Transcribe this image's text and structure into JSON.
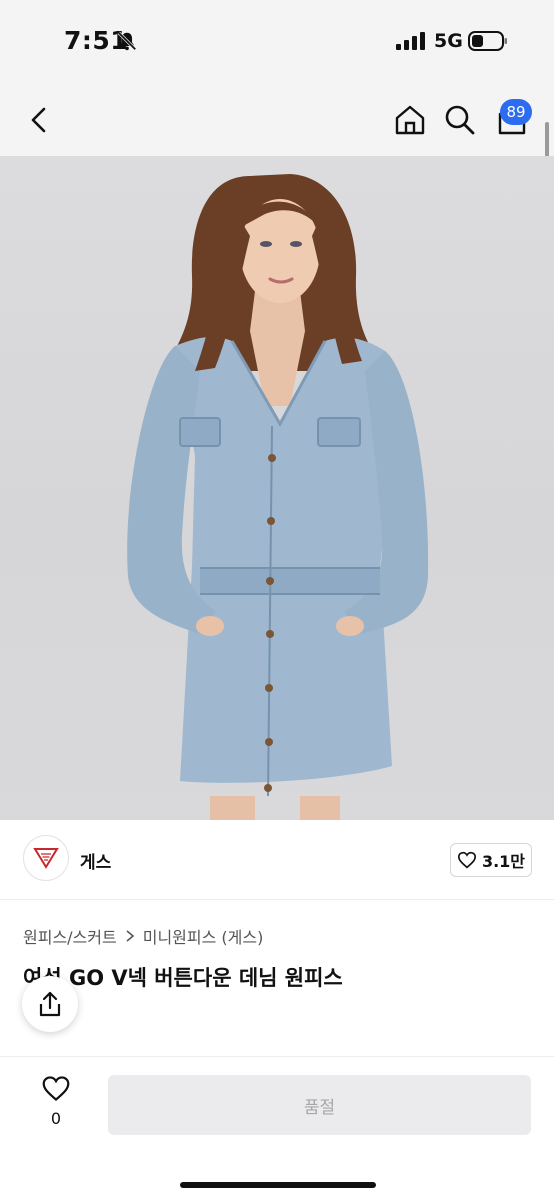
{
  "status_bar": {
    "time": "7:51",
    "network": "5G",
    "icons": [
      "bell-off-icon",
      "signal-icon",
      "battery-icon"
    ]
  },
  "header": {
    "icons": [
      "back-icon",
      "home-icon",
      "search-icon",
      "cart-icon"
    ],
    "cart_count": "89"
  },
  "brand": {
    "name": "게스",
    "likes": "3.1만"
  },
  "breadcrumb": {
    "category": "원피스/스커트",
    "subcategory": "미니원피스 (게스)"
  },
  "product": {
    "title": "여성 GO V넥 버튼다운 데님 원피스"
  },
  "bottom_bar": {
    "wish_count": "0",
    "soldout_label": "품절"
  },
  "colors": {
    "accent": "#2b6cf0",
    "denim": "#9fb8d0",
    "hair": "#6b3e26"
  }
}
